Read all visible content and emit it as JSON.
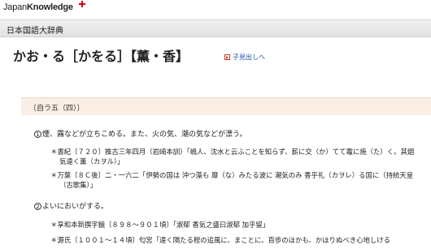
{
  "app": {
    "logo_text_1": "Japan",
    "logo_text_2": "Knowledge",
    "dictionary_name": "日本国語大辞典"
  },
  "entry": {
    "headword": "かお・る［かをる］【薫・香】",
    "subheading_link": "子見出しへ",
    "grammar": "〔自ラ五（四）〕"
  },
  "senses": [
    {
      "num": "1",
      "text": "煙、霧などが立ちこめる。また、火の気、潮の気などが漂う。",
      "citations": [
        {
          "line1": "＊書紀〔７２０〕推古三年四月（岩崎本訓）「嶋人、沈水と云ふことを知らず、薪に交（か）てて竈に焼（た）く。其烟",
          "line2": "気遠く薫（カヲル）」"
        },
        {
          "line1": "＊万葉〔８Ｃ後〕二・一六二「伊勢の国は 沖つ藻も 靡（な）みたる波に 潮気のみ 香乎礼（カヲレ）る国に（持統天皇",
          "line2": "（古歌集）」"
        }
      ]
    },
    {
      "num": "2",
      "text": "よいにおいがする。",
      "citations": [
        {
          "line1": "＊享和本新撰字鏡〔８９８～９０１頃〕「淑郁 香気之盛曰淑郁 加乎留」"
        },
        {
          "line1": "＊源氏〔１００１～１４頃〕匂宮「遠く隔たる程の追風に、まことに、百歩のほかも、かほりぬべき心地しける"
        }
      ]
    }
  ]
}
